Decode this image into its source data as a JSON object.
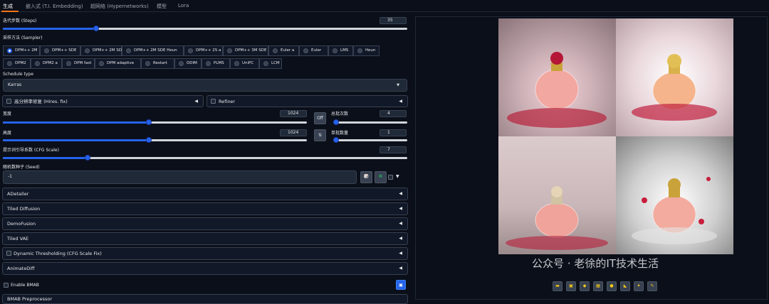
{
  "tabs": [
    "生成",
    "嵌入式 (T.I. Embedding)",
    "超网络 (Hypernetworks)",
    "模型",
    "Lora"
  ],
  "steps": {
    "label": "迭代步数 (Steps)",
    "value": "35",
    "fraction": 0.23
  },
  "sampler": {
    "label": "采样方法 (Sampler)",
    "selected": "DPM++ 2M",
    "row1": [
      "DPM++ 2M",
      "DPM++ SDE",
      "DPM++ 2M SDE",
      "DPM++ 2M SDE Heun",
      "DPM++ 2S a",
      "DPM++ 3M SDE",
      "Euler a",
      "Euler",
      "LMS",
      "Heun"
    ],
    "row2": [
      "DPM2",
      "DPM2 a",
      "DPM fast",
      "DPM adaptive",
      "Restart",
      "DDIM",
      "PLMS",
      "UniPC",
      "LCM"
    ]
  },
  "schedule": {
    "label": "Schedule type",
    "value": "Karras"
  },
  "hires": {
    "label": "高分辨率修复 (Hires. fix)"
  },
  "refiner": {
    "label": "Refiner"
  },
  "width": {
    "label": "宽度",
    "value": "1024",
    "fraction": 0.48
  },
  "height": {
    "label": "高度",
    "value": "1024",
    "fraction": 0.48
  },
  "batch_count": {
    "label": "总批次数",
    "value": "4",
    "fraction": 0.03
  },
  "batch_size": {
    "label": "单批数量",
    "value": "1",
    "fraction": 0.0
  },
  "off_button": "Off",
  "cfg": {
    "label": "提示词引导系数 (CFG Scale)",
    "value": "7",
    "fraction": 0.21
  },
  "seed": {
    "label": "随机数种子 (Seed)",
    "value": "-1"
  },
  "accordions": [
    "ADetailer",
    "Tiled Diffusion",
    "DemoFusion",
    "Tiled VAE",
    "Dynamic Thresholding (CFG Scale Fix)",
    "AnimateDiff"
  ],
  "bmab": {
    "enable_label": "Enable BMAB",
    "next": "BMAB Preprocessor"
  },
  "watermark": "公众号 · 老徐的IT技术生活",
  "colors": {
    "accent": "#2563eb",
    "bg": "#0b0f19",
    "orange": "#f97316"
  }
}
